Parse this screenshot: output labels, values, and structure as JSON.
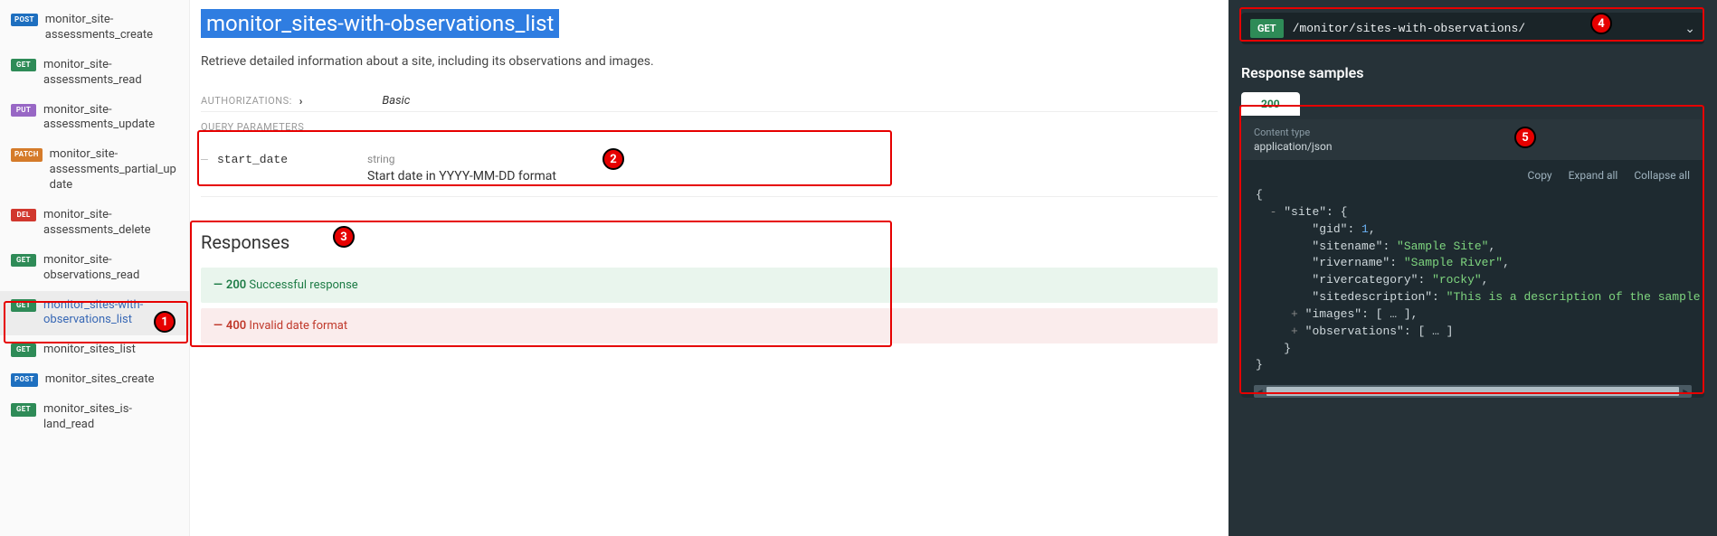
{
  "sidebar": {
    "items": [
      {
        "method": "POST",
        "cls": "post",
        "label": "monitor_site-assessments_create"
      },
      {
        "method": "GET",
        "cls": "get",
        "label": "monitor_site-assessments_read"
      },
      {
        "method": "PUT",
        "cls": "put",
        "label": "monitor_site-assessments_update"
      },
      {
        "method": "PATCH",
        "cls": "patch",
        "label": "monitor_site-assessments_partial_update"
      },
      {
        "method": "DEL",
        "cls": "del",
        "label": "monitor_site-assessments_delete"
      },
      {
        "method": "GET",
        "cls": "get",
        "label": "monitor_site-observations_read"
      },
      {
        "method": "GET",
        "cls": "get",
        "label": "monitor_sites-with-observations_list"
      },
      {
        "method": "GET",
        "cls": "get",
        "label": "monitor_sites_list"
      },
      {
        "method": "POST",
        "cls": "post",
        "label": "monitor_sites_create"
      },
      {
        "method": "GET",
        "cls": "get",
        "label": "monitor_sites_is-land_read"
      }
    ],
    "active_index": 6
  },
  "operation": {
    "title": "monitor_sites-with-observations_list",
    "description": "Retrieve detailed information about a site, including its observations and images.",
    "auth_label": "AUTHORIZATIONS:",
    "auth_value": "Basic",
    "query_label": "QUERY PARAMETERS",
    "params": [
      {
        "name": "start_date",
        "type": "string",
        "desc": "Start date in YYYY-MM-DD format"
      }
    ],
    "responses_heading": "Responses",
    "responses": [
      {
        "code": "200",
        "text": "Successful response",
        "kind": "ok"
      },
      {
        "code": "400",
        "text": "Invalid date format",
        "kind": "err"
      }
    ]
  },
  "right": {
    "method": "GET",
    "path": "/monitor/sites-with-observations/",
    "samples_heading": "Response samples",
    "status_tab": "200",
    "content_type_label": "Content type",
    "content_type_value": "application/json",
    "tools": {
      "copy": "Copy",
      "expand": "Expand all",
      "collapse": "Collapse all"
    },
    "json": {
      "site": {
        "gid": 1,
        "sitename": "Sample Site",
        "rivername": "Sample River",
        "rivercategory": "rocky",
        "sitedescription": "This is a description of the sample site."
      },
      "images_label": "images",
      "observations_label": "observations",
      "ellipsis": "…"
    }
  },
  "annotations": [
    {
      "n": "1"
    },
    {
      "n": "2"
    },
    {
      "n": "3"
    },
    {
      "n": "4"
    },
    {
      "n": "5"
    }
  ]
}
